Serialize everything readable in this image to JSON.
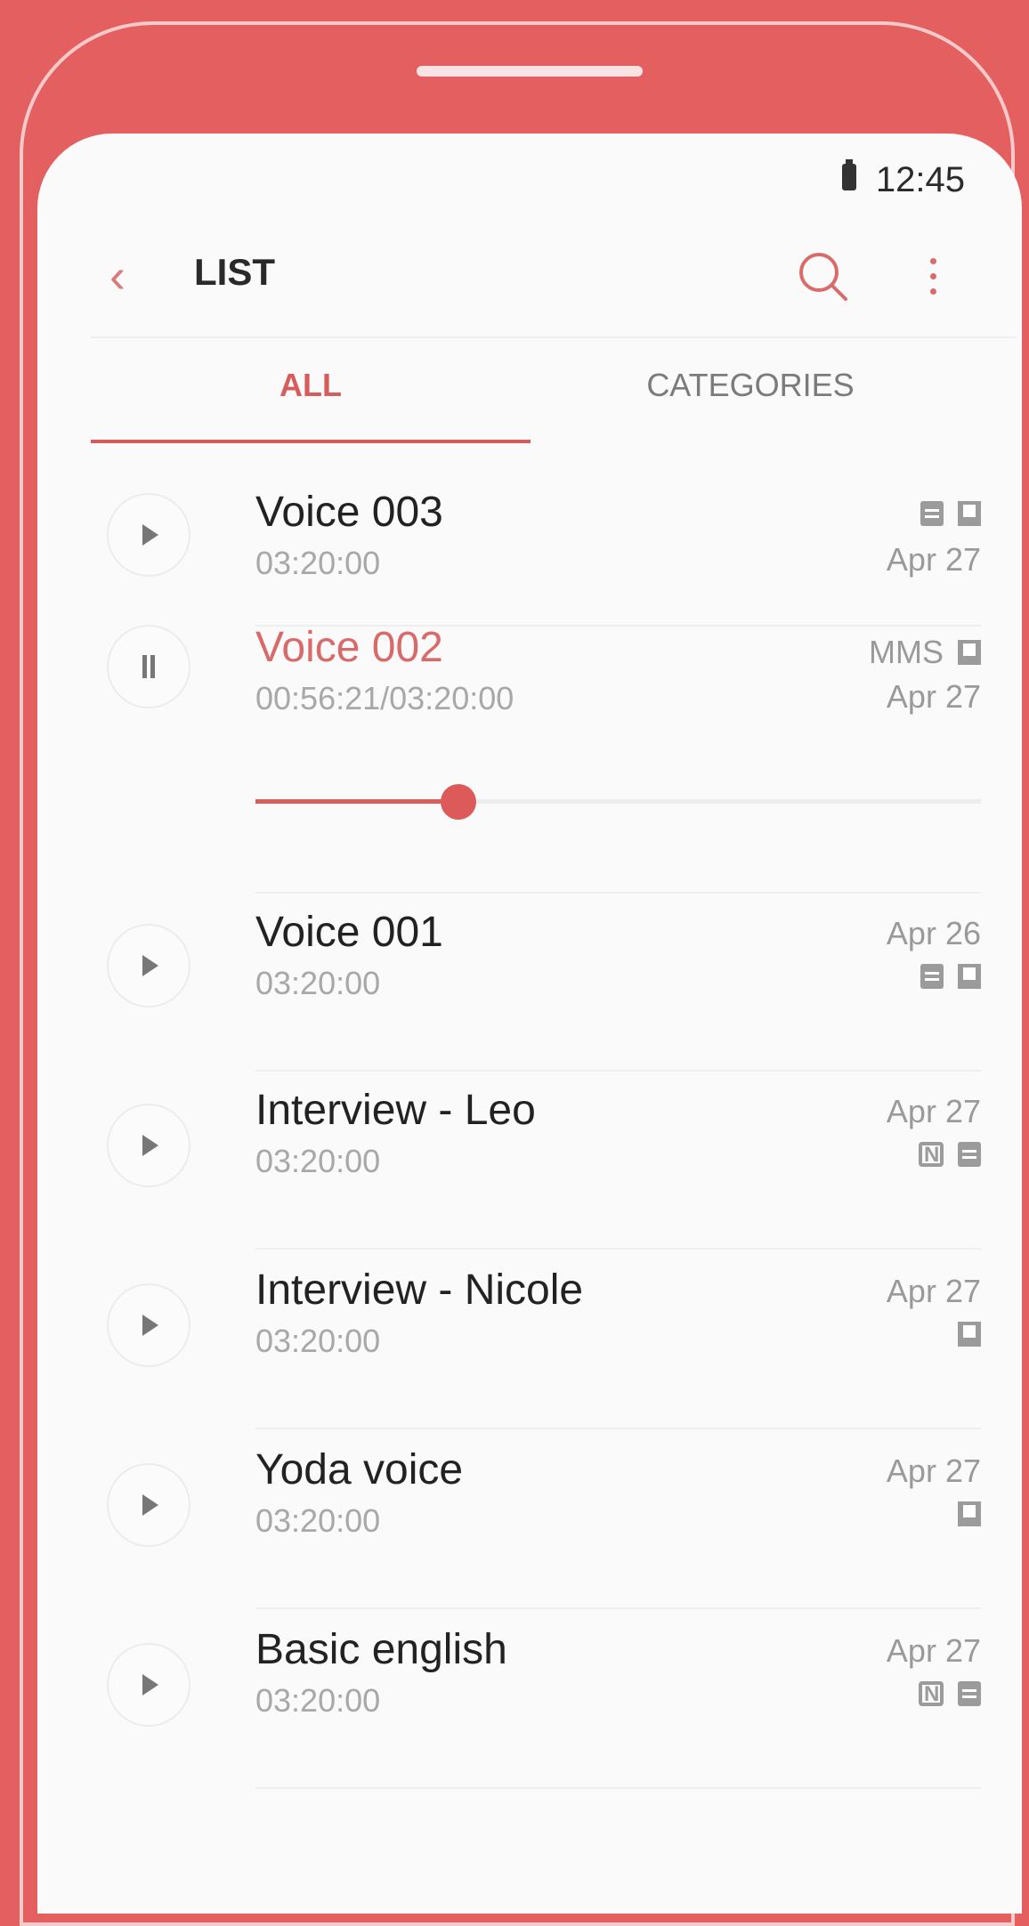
{
  "status_bar": {
    "time": "12:45"
  },
  "header": {
    "title": "LIST",
    "back_icon": "chevron-left-icon",
    "search_icon": "search-icon",
    "menu_icon": "more-vertical-icon"
  },
  "tabs": [
    {
      "label": "ALL",
      "selected": true
    },
    {
      "label": "CATEGORIES",
      "selected": false
    }
  ],
  "colors": {
    "accent": "#d85c5c",
    "frame": "#e45f5f",
    "text_primary": "#222222",
    "text_secondary": "#a8a8a8"
  },
  "recordings": [
    {
      "title": "Voice 003",
      "duration": "03:20:00",
      "date": "Apr 27",
      "icons": [
        "note-icon",
        "bookmark-icon"
      ],
      "playing": false
    },
    {
      "title": "Voice 002",
      "duration": "00:56:21/03:20:00",
      "date": "Apr 27",
      "badge": "MMS",
      "icons": [
        "bookmark-icon"
      ],
      "playing": true,
      "progress_fraction": 0.28
    },
    {
      "title": "Voice 001",
      "duration": "03:20:00",
      "date": "Apr 26",
      "icons": [
        "note-icon",
        "bookmark-icon"
      ],
      "playing": false
    },
    {
      "title": "Interview - Leo",
      "duration": "03:20:00",
      "date": "Apr 27",
      "icons": [
        "nfc-icon",
        "note-icon"
      ],
      "playing": false
    },
    {
      "title": "Interview - Nicole",
      "duration": "03:20:00",
      "date": "Apr 27",
      "icons": [
        "bookmark-icon"
      ],
      "playing": false
    },
    {
      "title": "Yoda voice",
      "duration": "03:20:00",
      "date": "Apr 27",
      "icons": [
        "bookmark-icon"
      ],
      "playing": false
    },
    {
      "title": "Basic english",
      "duration": "03:20:00",
      "date": "Apr 27",
      "icons": [
        "nfc-icon",
        "note-icon"
      ],
      "playing": false
    }
  ]
}
